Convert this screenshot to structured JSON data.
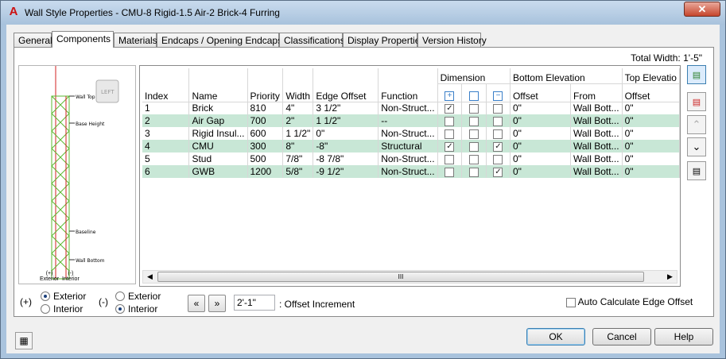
{
  "window": {
    "title": "Wall Style Properties - CMU-8 Rigid-1.5 Air-2 Brick-4 Furring",
    "close_glyph": "✕",
    "app_glyph": "A"
  },
  "tabs": [
    "General",
    "Components",
    "Materials",
    "Endcaps / Opening Endcaps",
    "Classifications",
    "Display Properties",
    "Version History"
  ],
  "total_width": "Total Width: 1'-5\"",
  "preview": {
    "left_label": "LEFT",
    "labels": {
      "wall_top": "Wall Top",
      "base_height": "Base Height",
      "baseline": "Baseline",
      "wall_bottom": "Wall Bottom"
    },
    "bottom_left": "(+)\nExterior",
    "bottom_right": "(-)\nInterior"
  },
  "table": {
    "headers": {
      "index": "Index",
      "name": "Name",
      "priority": "Priority",
      "width": "Width",
      "edge_offset": "Edge Offset",
      "function": "Function",
      "dimension": "Dimension",
      "bottom_elevation": "Bottom Elevation",
      "top_elevation": "Top Elevatio",
      "offset": "Offset",
      "from": "From",
      "top_offset": "Offset"
    },
    "rows": [
      {
        "index": "1",
        "name": "Brick",
        "priority": "810",
        "width": "4\"",
        "edge_offset": "3 1/2\"",
        "function": "Non-Struct...",
        "dim": [
          true,
          false,
          false
        ],
        "b_offset": "0\"",
        "from": "Wall Bott...",
        "t_offset": "0\""
      },
      {
        "index": "2",
        "name": "Air Gap",
        "priority": "700",
        "width": "2\"",
        "edge_offset": "1 1/2\"",
        "function": "--",
        "dim": [
          false,
          false,
          false
        ],
        "b_offset": "0\"",
        "from": "Wall Bott...",
        "t_offset": "0\""
      },
      {
        "index": "3",
        "name": "Rigid Insul...",
        "priority": "600",
        "width": "1 1/2\"",
        "edge_offset": "0\"",
        "function": "Non-Struct...",
        "dim": [
          false,
          false,
          false
        ],
        "b_offset": "0\"",
        "from": "Wall Bott...",
        "t_offset": "0\""
      },
      {
        "index": "4",
        "name": "CMU",
        "priority": "300",
        "width": "8\"",
        "edge_offset": "-8\"",
        "function": "Structural",
        "dim": [
          true,
          false,
          true
        ],
        "b_offset": "0\"",
        "from": "Wall Bott...",
        "t_offset": "0\""
      },
      {
        "index": "5",
        "name": "Stud",
        "priority": "500",
        "width": "7/8\"",
        "edge_offset": "-8 7/8\"",
        "function": "Non-Struct...",
        "dim": [
          false,
          false,
          false
        ],
        "b_offset": "0\"",
        "from": "Wall Bott...",
        "t_offset": "0\""
      },
      {
        "index": "6",
        "name": "GWB",
        "priority": "1200",
        "width": "5/8\"",
        "edge_offset": "-9 1/2\"",
        "function": "Non-Struct...",
        "dim": [
          false,
          false,
          true
        ],
        "b_offset": "0\"",
        "from": "Wall Bott...",
        "t_offset": "0\""
      }
    ],
    "scroll_grip": "III"
  },
  "side_buttons": [
    "add-component",
    "remove-component",
    "move-up",
    "move-down",
    "list-edit"
  ],
  "plus_group": {
    "label": "(+)",
    "options": [
      {
        "label": "Exterior",
        "selected": true
      },
      {
        "label": "Interior",
        "selected": false
      }
    ]
  },
  "minus_group": {
    "label": "(-)",
    "options": [
      {
        "label": "Exterior",
        "selected": false
      },
      {
        "label": "Interior",
        "selected": true
      }
    ]
  },
  "offset": {
    "prev_glyph": "«",
    "next_glyph": "»",
    "value": "2'-1\"",
    "label": ": Offset Increment"
  },
  "auto_calc": {
    "label": "Auto Calculate Edge Offset",
    "checked": false
  },
  "buttons": {
    "ok": "OK",
    "cancel": "Cancel",
    "help": "Help"
  },
  "colors": {
    "title_bg": "#a9c3dd",
    "row_alt": "#c8e7d6",
    "preview_red": "#d32222",
    "preview_green": "#5bb830"
  }
}
